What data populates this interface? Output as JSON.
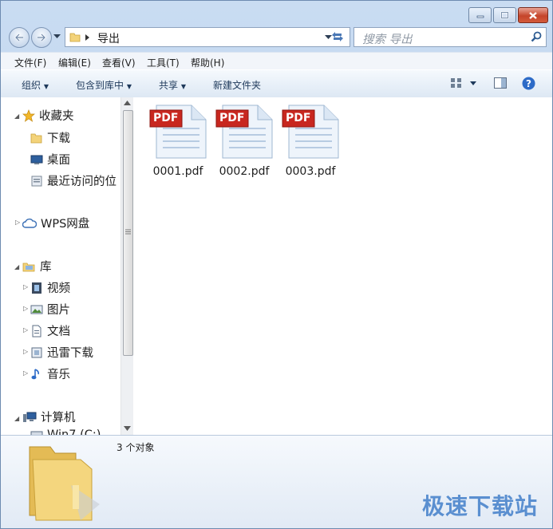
{
  "address": {
    "segment": "导出"
  },
  "search": {
    "placeholder": "搜索 导出"
  },
  "menu": [
    "文件(F)",
    "编辑(E)",
    "查看(V)",
    "工具(T)",
    "帮助(H)"
  ],
  "commands": {
    "organize": "组织",
    "include": "包含到库中",
    "share": "共享",
    "new_folder": "新建文件夹"
  },
  "nav": {
    "favorites": "收藏夹",
    "downloads": "下载",
    "desktop": "桌面",
    "recent": "最近访问的位",
    "wps": "WPS网盘",
    "libraries": "库",
    "videos": "视频",
    "pictures": "图片",
    "documents": "文档",
    "thunder": "迅雷下载",
    "music": "音乐",
    "computer": "计算机",
    "partial": "Win7 (C:)"
  },
  "files": [
    {
      "name": "0001.pdf",
      "badge": "PDF"
    },
    {
      "name": "0002.pdf",
      "badge": "PDF"
    },
    {
      "name": "0003.pdf",
      "badge": "PDF"
    }
  ],
  "status": {
    "count": "3 个对象"
  },
  "watermark": "极速下载站",
  "colors": {
    "pdf_badge": "#c8271f",
    "folder": "#f3d37a",
    "link": "#1e395b"
  }
}
